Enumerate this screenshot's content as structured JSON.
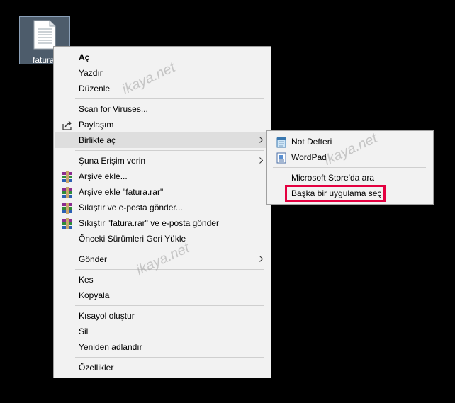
{
  "desktop": {
    "file_label": "fatura.rar"
  },
  "context_menu": {
    "items": [
      {
        "label": "Aç"
      },
      {
        "label": "Yazdır"
      },
      {
        "label": "Düzenle"
      },
      {
        "label": "Scan for Viruses..."
      },
      {
        "label": "Paylaşım"
      },
      {
        "label": "Birlikte aç"
      },
      {
        "label": "Şuna Erişim verin"
      },
      {
        "label": "Arşive ekle..."
      },
      {
        "label": "Arşive ekle \"fatura.rar\""
      },
      {
        "label": "Sıkıştır ve e-posta gönder..."
      },
      {
        "label": "Sıkıştır \"fatura.rar\" ve e-posta gönder"
      },
      {
        "label": "Önceki Sürümleri Geri Yükle"
      },
      {
        "label": "Gönder"
      },
      {
        "label": "Kes"
      },
      {
        "label": "Kopyala"
      },
      {
        "label": "Kısayol oluştur"
      },
      {
        "label": "Sil"
      },
      {
        "label": "Yeniden adlandır"
      },
      {
        "label": "Özellikler"
      }
    ]
  },
  "open_with_submenu": {
    "items": [
      {
        "label": "Not Defteri"
      },
      {
        "label": "WordPad"
      },
      {
        "label": "Microsoft Store'da ara"
      },
      {
        "label": "Başka bir uygulama seç"
      }
    ]
  },
  "watermark": {
    "text": "ikaya.net"
  },
  "colors": {
    "highlight_box": "#e40040",
    "menu_bg": "#f2f2f2",
    "hover_bg": "#dedede"
  }
}
